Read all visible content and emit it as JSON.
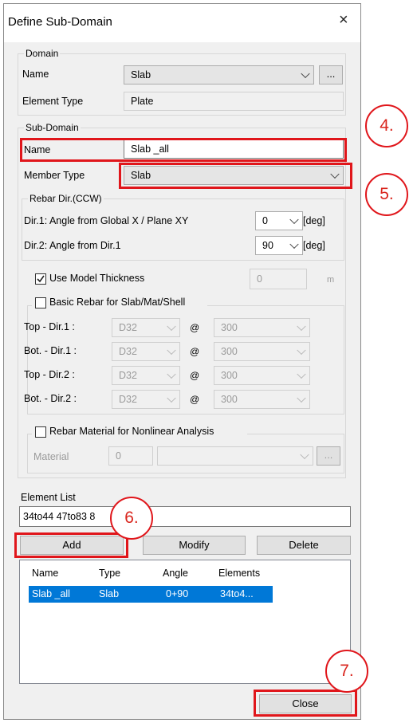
{
  "dialog": {
    "title": "Define Sub-Domain",
    "close_symbol": "×"
  },
  "domain": {
    "group_label": "Domain",
    "name_label": "Name",
    "name_value": "Slab",
    "browse_label": "...",
    "element_type_label": "Element Type",
    "element_type_value": "Plate"
  },
  "subdomain": {
    "group_label": "Sub-Domain",
    "name_label": "Name",
    "name_value": "Slab _all",
    "member_type_label": "Member Type",
    "member_type_value": "Slab"
  },
  "rebar_dir": {
    "group_label": "Rebar Dir.(CCW)",
    "dir1_label": "Dir.1: Angle from Global X / Plane XY",
    "dir1_value": "0",
    "dir2_label": "Dir.2: Angle from Dir.1",
    "dir2_value": "90",
    "unit": "[deg]"
  },
  "thickness": {
    "checkbox_label": "Use Model Thickness",
    "checked": true,
    "value": "0",
    "unit": "m"
  },
  "basic_rebar": {
    "checkbox_label": "Basic Rebar for Slab/Mat/Shell",
    "checked": false,
    "at_symbol": "@",
    "rows": [
      {
        "label": "Top - Dir.1 :",
        "bar": "D32",
        "spacing": "300"
      },
      {
        "label": "Bot. - Dir.1 :",
        "bar": "D32",
        "spacing": "300"
      },
      {
        "label": "Top - Dir.2 :",
        "bar": "D32",
        "spacing": "300"
      },
      {
        "label": "Bot. - Dir.2 :",
        "bar": "D32",
        "spacing": "300"
      }
    ]
  },
  "rebar_material": {
    "checkbox_label": "Rebar Material for Nonlinear Analysis",
    "checked": false,
    "material_label": "Material",
    "material_id": "0",
    "browse_label": "..."
  },
  "element_list": {
    "label": "Element List",
    "value": "34to44 47to83 8"
  },
  "buttons": {
    "add": "Add",
    "modify": "Modify",
    "delete": "Delete",
    "close": "Close"
  },
  "table": {
    "columns": [
      "Name",
      "Type",
      "Angle",
      "Elements"
    ],
    "rows": [
      {
        "name": "Slab _all",
        "type": "Slab",
        "angle": "0+90",
        "elements": "34to4..."
      }
    ]
  },
  "callouts": [
    "4.",
    "5.",
    "6.",
    "7."
  ],
  "colors": {
    "annotation_red": "#e0161b",
    "selection_blue": "#0078d7"
  }
}
